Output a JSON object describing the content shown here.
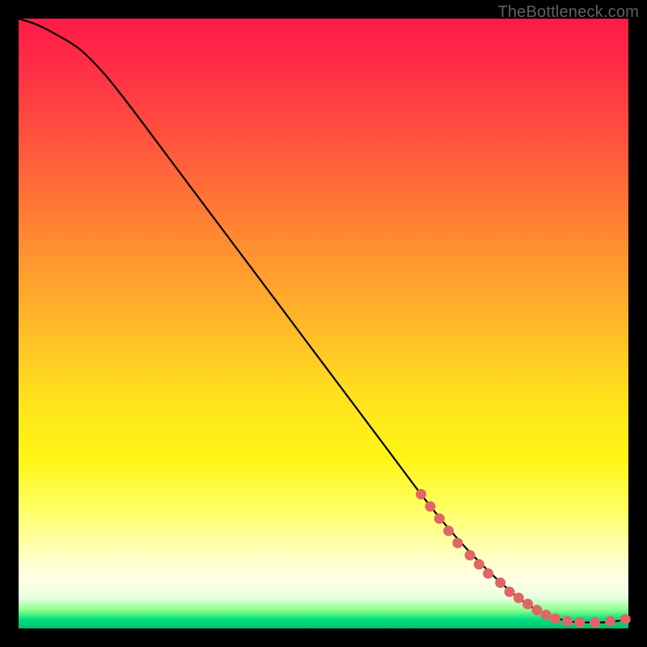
{
  "attribution": "TheBottleneck.com",
  "colors": {
    "curve": "#000000",
    "marker_fill": "#e06666",
    "marker_stroke": "#c05050"
  },
  "chart_data": {
    "type": "line",
    "title": "",
    "xlabel": "",
    "ylabel": "",
    "xlim": [
      0,
      100
    ],
    "ylim": [
      0,
      100
    ],
    "grid": false,
    "series": [
      {
        "name": "curve",
        "x": [
          0,
          3,
          6,
          10,
          14,
          18,
          24,
          30,
          36,
          42,
          48,
          54,
          60,
          66,
          70,
          74,
          78,
          82,
          85,
          88,
          90,
          92,
          94,
          96,
          98,
          100
        ],
        "y": [
          100,
          99,
          97.5,
          95,
          91,
          86,
          78,
          70,
          62,
          54,
          46,
          38,
          30,
          22,
          17,
          12.5,
          8.5,
          5,
          3,
          1.8,
          1.2,
          1.0,
          1.0,
          1.0,
          1.2,
          1.5
        ]
      }
    ],
    "markers": [
      {
        "x": 66,
        "y": 22
      },
      {
        "x": 67.5,
        "y": 20
      },
      {
        "x": 69,
        "y": 18
      },
      {
        "x": 70.5,
        "y": 16
      },
      {
        "x": 72,
        "y": 14
      },
      {
        "x": 74,
        "y": 12
      },
      {
        "x": 75.5,
        "y": 10.5
      },
      {
        "x": 77,
        "y": 9
      },
      {
        "x": 79,
        "y": 7.5
      },
      {
        "x": 80.5,
        "y": 6
      },
      {
        "x": 82,
        "y": 5
      },
      {
        "x": 83.5,
        "y": 4
      },
      {
        "x": 85,
        "y": 3
      },
      {
        "x": 86.5,
        "y": 2.2
      },
      {
        "x": 88,
        "y": 1.6
      },
      {
        "x": 90,
        "y": 1.2
      },
      {
        "x": 92,
        "y": 1.0
      },
      {
        "x": 94.5,
        "y": 1.0
      },
      {
        "x": 97,
        "y": 1.2
      },
      {
        "x": 99.5,
        "y": 1.5
      }
    ]
  }
}
